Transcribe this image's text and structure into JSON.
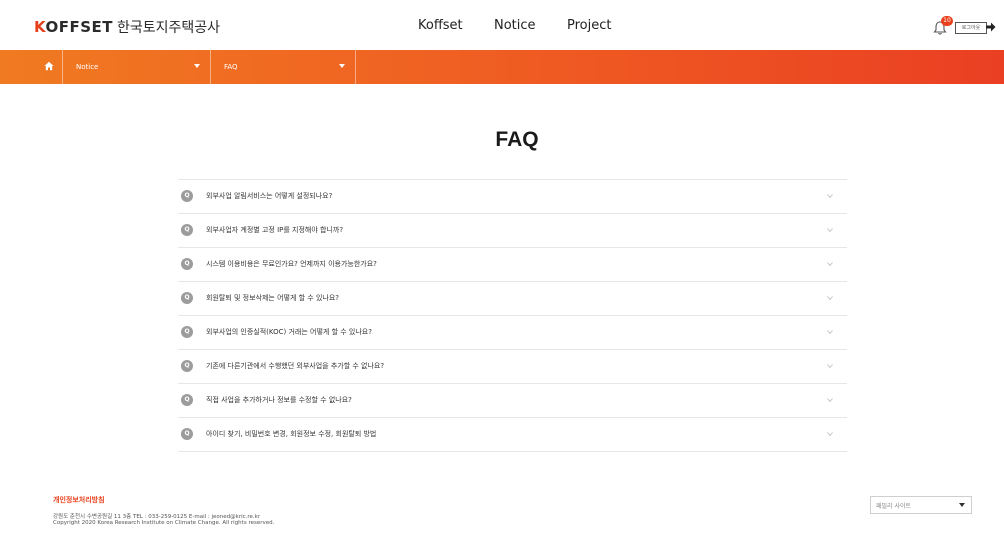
{
  "header": {
    "logo_k": "K",
    "logo_rest": "OFFSET",
    "logo_kr": "한국토지주택공사",
    "nav": [
      "Koffset",
      "Notice",
      "Project"
    ],
    "alarm_count": "10",
    "login_label": "로그아웃"
  },
  "location": {
    "segments": [
      {
        "label": "Notice"
      },
      {
        "label": "FAQ"
      }
    ]
  },
  "page": {
    "title": "FAQ"
  },
  "faq": {
    "q_label": "Q",
    "items": [
      "외부사업 알림서비스는 어떻게 설정되나요?",
      "외부사업자 계정별 고정 IP를 지정해야 합니까?",
      "시스템 이용비용은 무료인가요? 언제까지 이용가능한가요?",
      "회원탈퇴 및 정보삭제는 어떻게 할 수 있나요?",
      "외부사업의 인증실적(KOC) 거래는 어떻게 할 수 있나요?",
      "기존에 다른기관에서 수행했던 외부사업을 추가할 수 없나요?",
      "직접 사업을 추가하거나 정보를 수정할 수 없나요?",
      "아이디 찾기, 비밀번호 변경, 회원정보 수정, 회원탈퇴 방법"
    ]
  },
  "footer": {
    "policy": "개인정보처리방침",
    "address": "강원도 춘천시 수변공원길 11 3층    TEL : 033-259-0125    E-mail : jeoned@kric.re.kr",
    "copyright": "Copyright 2020 Korea Research Institute on Climate Change. All rights reserved.",
    "family_site": "패밀리 사이트"
  },
  "colors": {
    "accent": "#e8401c",
    "bar_start": "#f07a21",
    "bar_end": "#ea3f23"
  }
}
